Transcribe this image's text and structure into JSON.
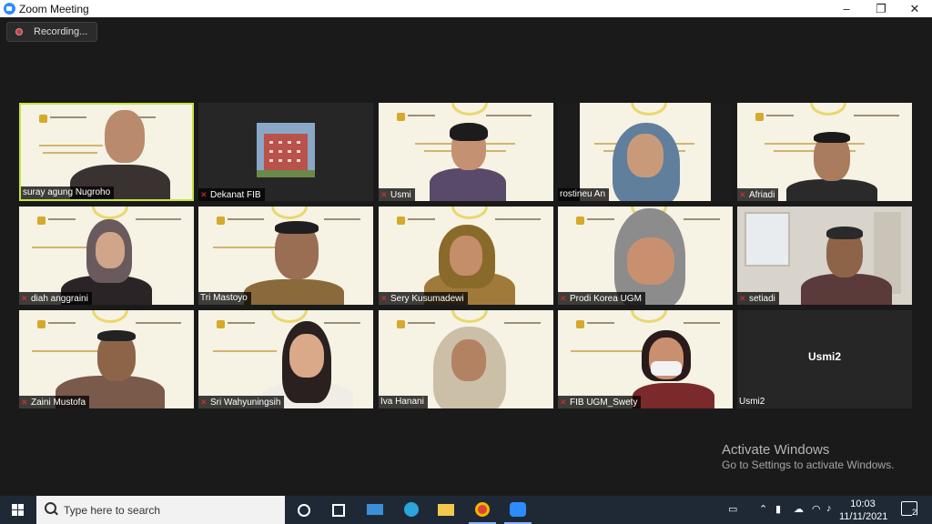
{
  "window": {
    "title": "Zoom Meeting",
    "controls": {
      "minimize": "–",
      "maximize": "❐",
      "close": "✕"
    }
  },
  "recording": {
    "label": "Recording..."
  },
  "participants": [
    {
      "name": "suray agung Nugroho",
      "muted": false,
      "active_speaker": true
    },
    {
      "name": "Dekanat FIB",
      "muted": true
    },
    {
      "name": "Usmi",
      "muted": true
    },
    {
      "name": "rostineu An",
      "muted": false
    },
    {
      "name": "Afriadi",
      "muted": true
    },
    {
      "name": "diah anggraini",
      "muted": true
    },
    {
      "name": "Tri Mastoyo",
      "muted": true
    },
    {
      "name": "Sery Kusumadewi",
      "muted": true
    },
    {
      "name": "Prodi Korea UGM",
      "muted": true
    },
    {
      "name": "setiadi",
      "muted": true
    },
    {
      "name": "Zaini Mustofa",
      "muted": true
    },
    {
      "name": "Sri Wahyuningsih",
      "muted": true
    },
    {
      "name": "Iva Hanani",
      "muted": true
    },
    {
      "name": "FIB UGM_Swety",
      "muted": true
    },
    {
      "name": "Usmi2",
      "muted": false,
      "video_off": true,
      "display_name": "Usmi2"
    }
  ],
  "watermark": {
    "line1": "Activate Windows",
    "line2": "Go to Settings to activate Windows."
  },
  "taskbar": {
    "search_placeholder": "Type here to search",
    "clock_time": "10:03",
    "clock_date": "11/11/2021",
    "notification_count": "2"
  },
  "colors": {
    "active_border": "#c8e43c",
    "muted_icon": "#e03030",
    "taskbar_bg": "#1f2936"
  }
}
